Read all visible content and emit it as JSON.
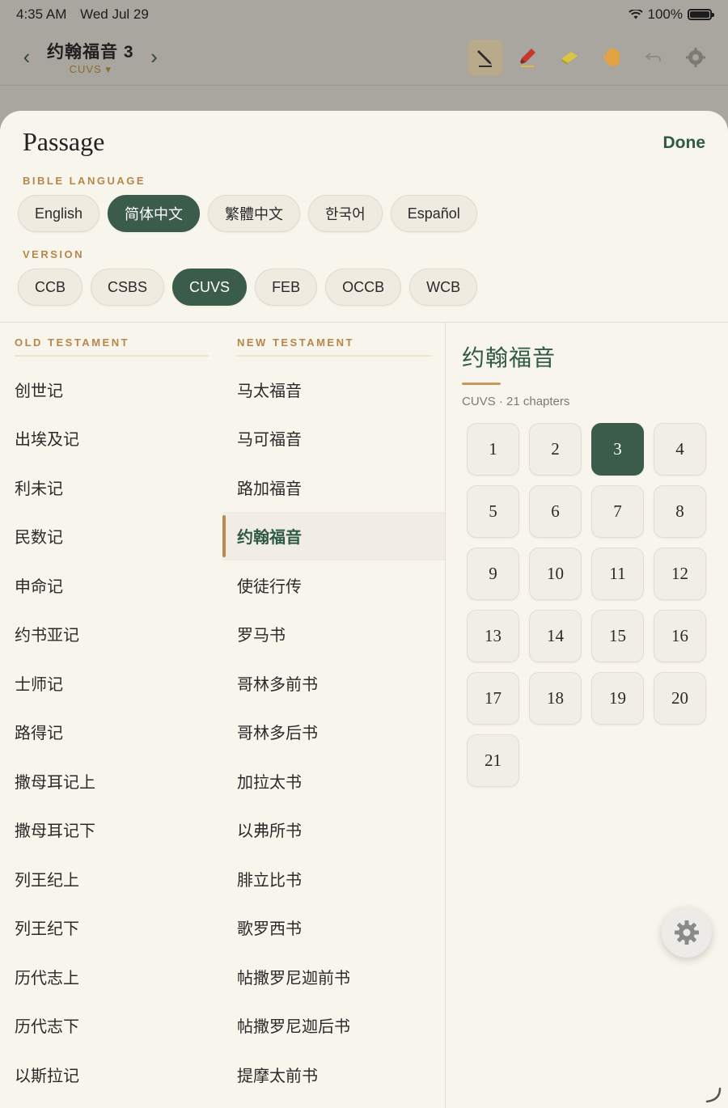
{
  "status_bar": {
    "time": "4:35 AM",
    "date": "Wed Jul 29",
    "battery": "100%"
  },
  "header": {
    "book_title": "约翰福音 3",
    "version": "CUVS ▾",
    "prev_icon": "chevron-left-icon",
    "next_icon": "chevron-right-icon",
    "tools": [
      "pen-icon",
      "highlighter-icon",
      "eraser-icon",
      "hand-icon",
      "undo-icon",
      "settings-icon"
    ]
  },
  "sheet": {
    "title": "Passage",
    "done_label": "Done",
    "language_label": "BIBLE LANGUAGE",
    "languages": [
      {
        "label": "English",
        "selected": false
      },
      {
        "label": "简体中文",
        "selected": true
      },
      {
        "label": "繁體中文",
        "selected": false
      },
      {
        "label": "한국어",
        "selected": false
      },
      {
        "label": "Español",
        "selected": false
      }
    ],
    "version_label": "VERSION",
    "versions": [
      {
        "label": "CCB",
        "selected": false
      },
      {
        "label": "CSBS",
        "selected": false
      },
      {
        "label": "CUVS",
        "selected": true
      },
      {
        "label": "FEB",
        "selected": false
      },
      {
        "label": "OCCB",
        "selected": false
      },
      {
        "label": "WCB",
        "selected": false
      }
    ]
  },
  "old_testament": {
    "label": "OLD TESTAMENT",
    "books": [
      "创世记",
      "出埃及记",
      "利未记",
      "民数记",
      "申命记",
      "约书亚记",
      "士师记",
      "路得记",
      "撒母耳记上",
      "撒母耳记下",
      "列王纪上",
      "列王纪下",
      "历代志上",
      "历代志下",
      "以斯拉记"
    ]
  },
  "new_testament": {
    "label": "NEW TESTAMENT",
    "books": [
      "马太福音",
      "马可福音",
      "路加福音",
      "约翰福音",
      "使徒行传",
      "罗马书",
      "哥林多前书",
      "哥林多后书",
      "加拉太书",
      "以弗所书",
      "腓立比书",
      "歌罗西书",
      "帖撒罗尼迦前书",
      "帖撒罗尼迦后书",
      "提摩太前书"
    ],
    "selected_index": 3
  },
  "chapter_panel": {
    "title": "约翰福音",
    "subtitle": "CUVS · 21 chapters",
    "chapters": [
      "1",
      "2",
      "3",
      "4",
      "5",
      "6",
      "7",
      "8",
      "9",
      "10",
      "11",
      "12",
      "13",
      "14",
      "15",
      "16",
      "17",
      "18",
      "19",
      "20",
      "21"
    ],
    "selected": "3"
  },
  "colors": {
    "accent_green": "#3c5c4b",
    "accent_gold": "#b6864a",
    "sheet_bg": "#f8f5ec"
  }
}
